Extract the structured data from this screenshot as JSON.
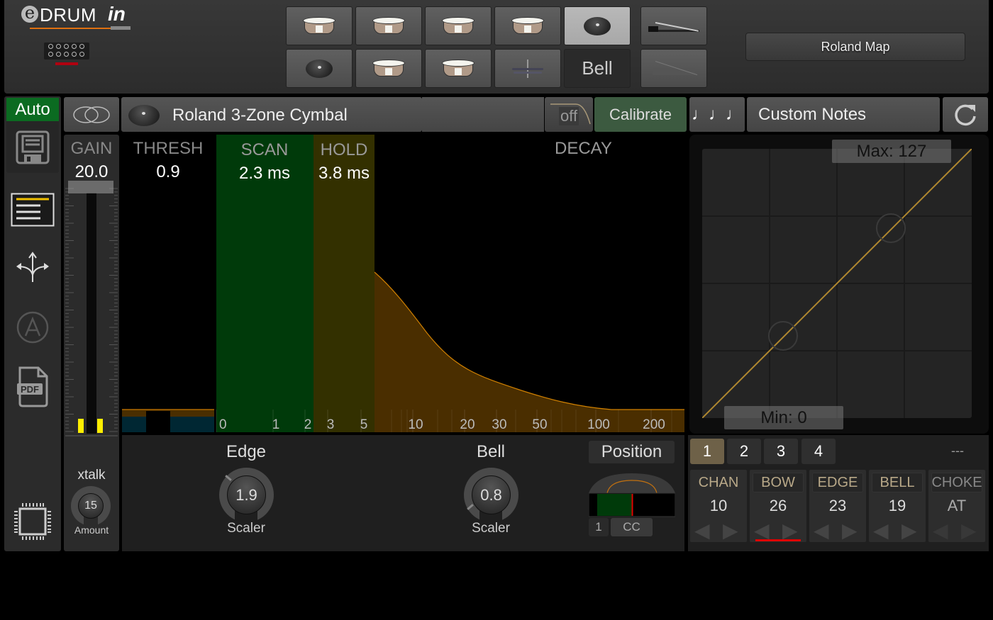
{
  "app": {
    "logo_prefix": "e",
    "logo_main": "DRUM",
    "logo_suffix": "in"
  },
  "pad_grid": {
    "row1": [
      {
        "icon": "drum-icon",
        "selected": false
      },
      {
        "icon": "drum-icon",
        "selected": false
      },
      {
        "icon": "drum-icon",
        "selected": false
      },
      {
        "icon": "drum-icon",
        "selected": false
      },
      {
        "icon": "cymbal-icon",
        "selected": true
      },
      {
        "icon": "hihat-pedal-icon",
        "selected": false
      }
    ],
    "row2": [
      {
        "icon": "cymbal-icon",
        "selected": false
      },
      {
        "icon": "drum-icon",
        "selected": false
      },
      {
        "icon": "drum-icon",
        "selected": false
      },
      {
        "icon": "hihat-icon",
        "selected": false
      },
      {
        "icon": "text",
        "label": "Bell",
        "selected": false
      },
      {
        "icon": "pedal-controller-icon",
        "selected": false
      }
    ]
  },
  "roland_map_label": "Roland Map",
  "sidebar": {
    "auto_label": "Auto",
    "items": [
      "save-icon",
      "list-icon",
      "routing-icon",
      "a-circle-icon",
      "pdf-icon",
      "chip-icon"
    ],
    "pdf_text": "PDF"
  },
  "header": {
    "pad_name": "Roland 3-Zone Cymbal",
    "off_label": "off",
    "calibrate_label": "Calibrate",
    "notes_icon": "♩♩♩",
    "custom_notes_label": "Custom Notes"
  },
  "params": {
    "gain": {
      "label": "GAIN",
      "value": "20.0"
    },
    "thresh": {
      "label": "THRESH",
      "value": "0.9"
    },
    "scan": {
      "label": "SCAN",
      "value": "2.3 ms"
    },
    "hold": {
      "label": "HOLD",
      "value": "3.8 ms"
    },
    "decay": {
      "label": "DECAY"
    }
  },
  "time_axis": {
    "ticks": [
      "0",
      "1",
      "2",
      "3",
      "5",
      "10",
      "20",
      "30",
      "50",
      "100",
      "200"
    ],
    "unit": "ms"
  },
  "velocity_curve": {
    "max_label": "Max: 127",
    "min_label": "Min: 0",
    "min": 0,
    "max": 127
  },
  "xtalk": {
    "label": "xtalk",
    "value": "15",
    "sub_label": "Amount"
  },
  "edge": {
    "label": "Edge",
    "value": "1.9",
    "sub_label": "Scaler"
  },
  "bell": {
    "label": "Bell",
    "value": "0.8",
    "sub_label": "Scaler"
  },
  "position": {
    "label": "Position",
    "channel_value": "1",
    "cc_label": "CC",
    "fraction": 0.45
  },
  "midi": {
    "tabs": [
      "1",
      "2",
      "3",
      "4"
    ],
    "selected_tab": "1",
    "status": "---",
    "columns": [
      {
        "header": "CHAN",
        "value": "10"
      },
      {
        "header": "BOW",
        "value": "26"
      },
      {
        "header": "EDGE",
        "value": "23"
      },
      {
        "header": "BELL",
        "value": "19"
      },
      {
        "header": "CHOKE",
        "value": "AT"
      }
    ]
  }
}
